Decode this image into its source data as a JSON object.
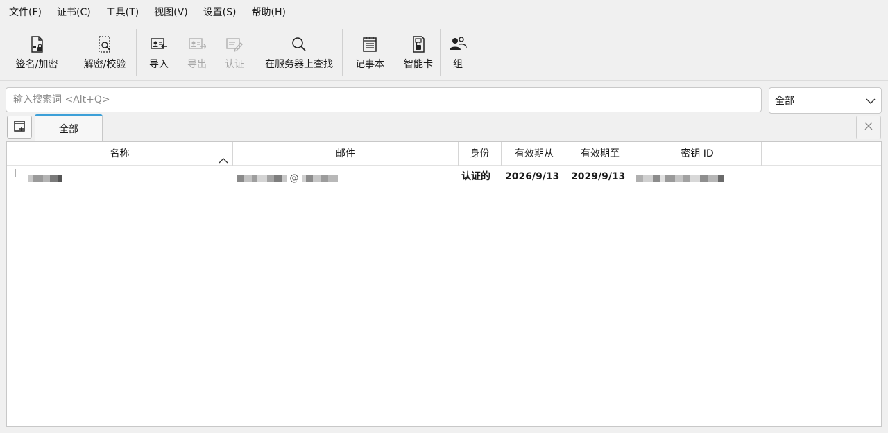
{
  "menu": [
    "文件(F)",
    "证书(C)",
    "工具(T)",
    "视图(V)",
    "设置(S)",
    "帮助(H)"
  ],
  "toolbar": {
    "sign_encrypt": "签名/加密",
    "decrypt_verify": "解密/校验",
    "import": "导入",
    "export": "导出",
    "certify": "认证",
    "lookup_server": "在服务器上查找",
    "notepad": "记事本",
    "smartcard": "智能卡",
    "group": "组"
  },
  "search": {
    "placeholder": "输入搜索词 <Alt+Q>",
    "value": ""
  },
  "filter": {
    "selected": "全部"
  },
  "tabs": [
    {
      "label": "全部",
      "active": true
    }
  ],
  "table": {
    "columns": [
      "名称",
      "邮件",
      "身份",
      "有效期从",
      "有效期至",
      "密钥 ID"
    ],
    "sort_column": "名称",
    "rows": [
      {
        "name": "(redacted)",
        "email_at": "@",
        "validity": "认证的",
        "valid_from": "2026/9/13",
        "valid_until": "2029/9/13",
        "key_id": "(redacted)"
      }
    ]
  },
  "colors": {
    "accent": "#3da0d8",
    "background": "#f0f0f0",
    "disabled_text": "#a8a8a8"
  },
  "icons": {
    "sign_encrypt": "document-lock-icon",
    "decrypt_verify": "document-search-icon",
    "import": "import-certificate-icon",
    "export": "export-certificate-icon",
    "certify": "certify-icon",
    "lookup_server": "magnifier-icon",
    "notepad": "notepad-icon",
    "smartcard": "smartcard-icon",
    "group": "group-icon",
    "new_tab": "new-tab-icon",
    "close_tab": "close-icon",
    "filter_dropdown": "chevron-down-icon",
    "sort": "sort-ascending-icon"
  }
}
